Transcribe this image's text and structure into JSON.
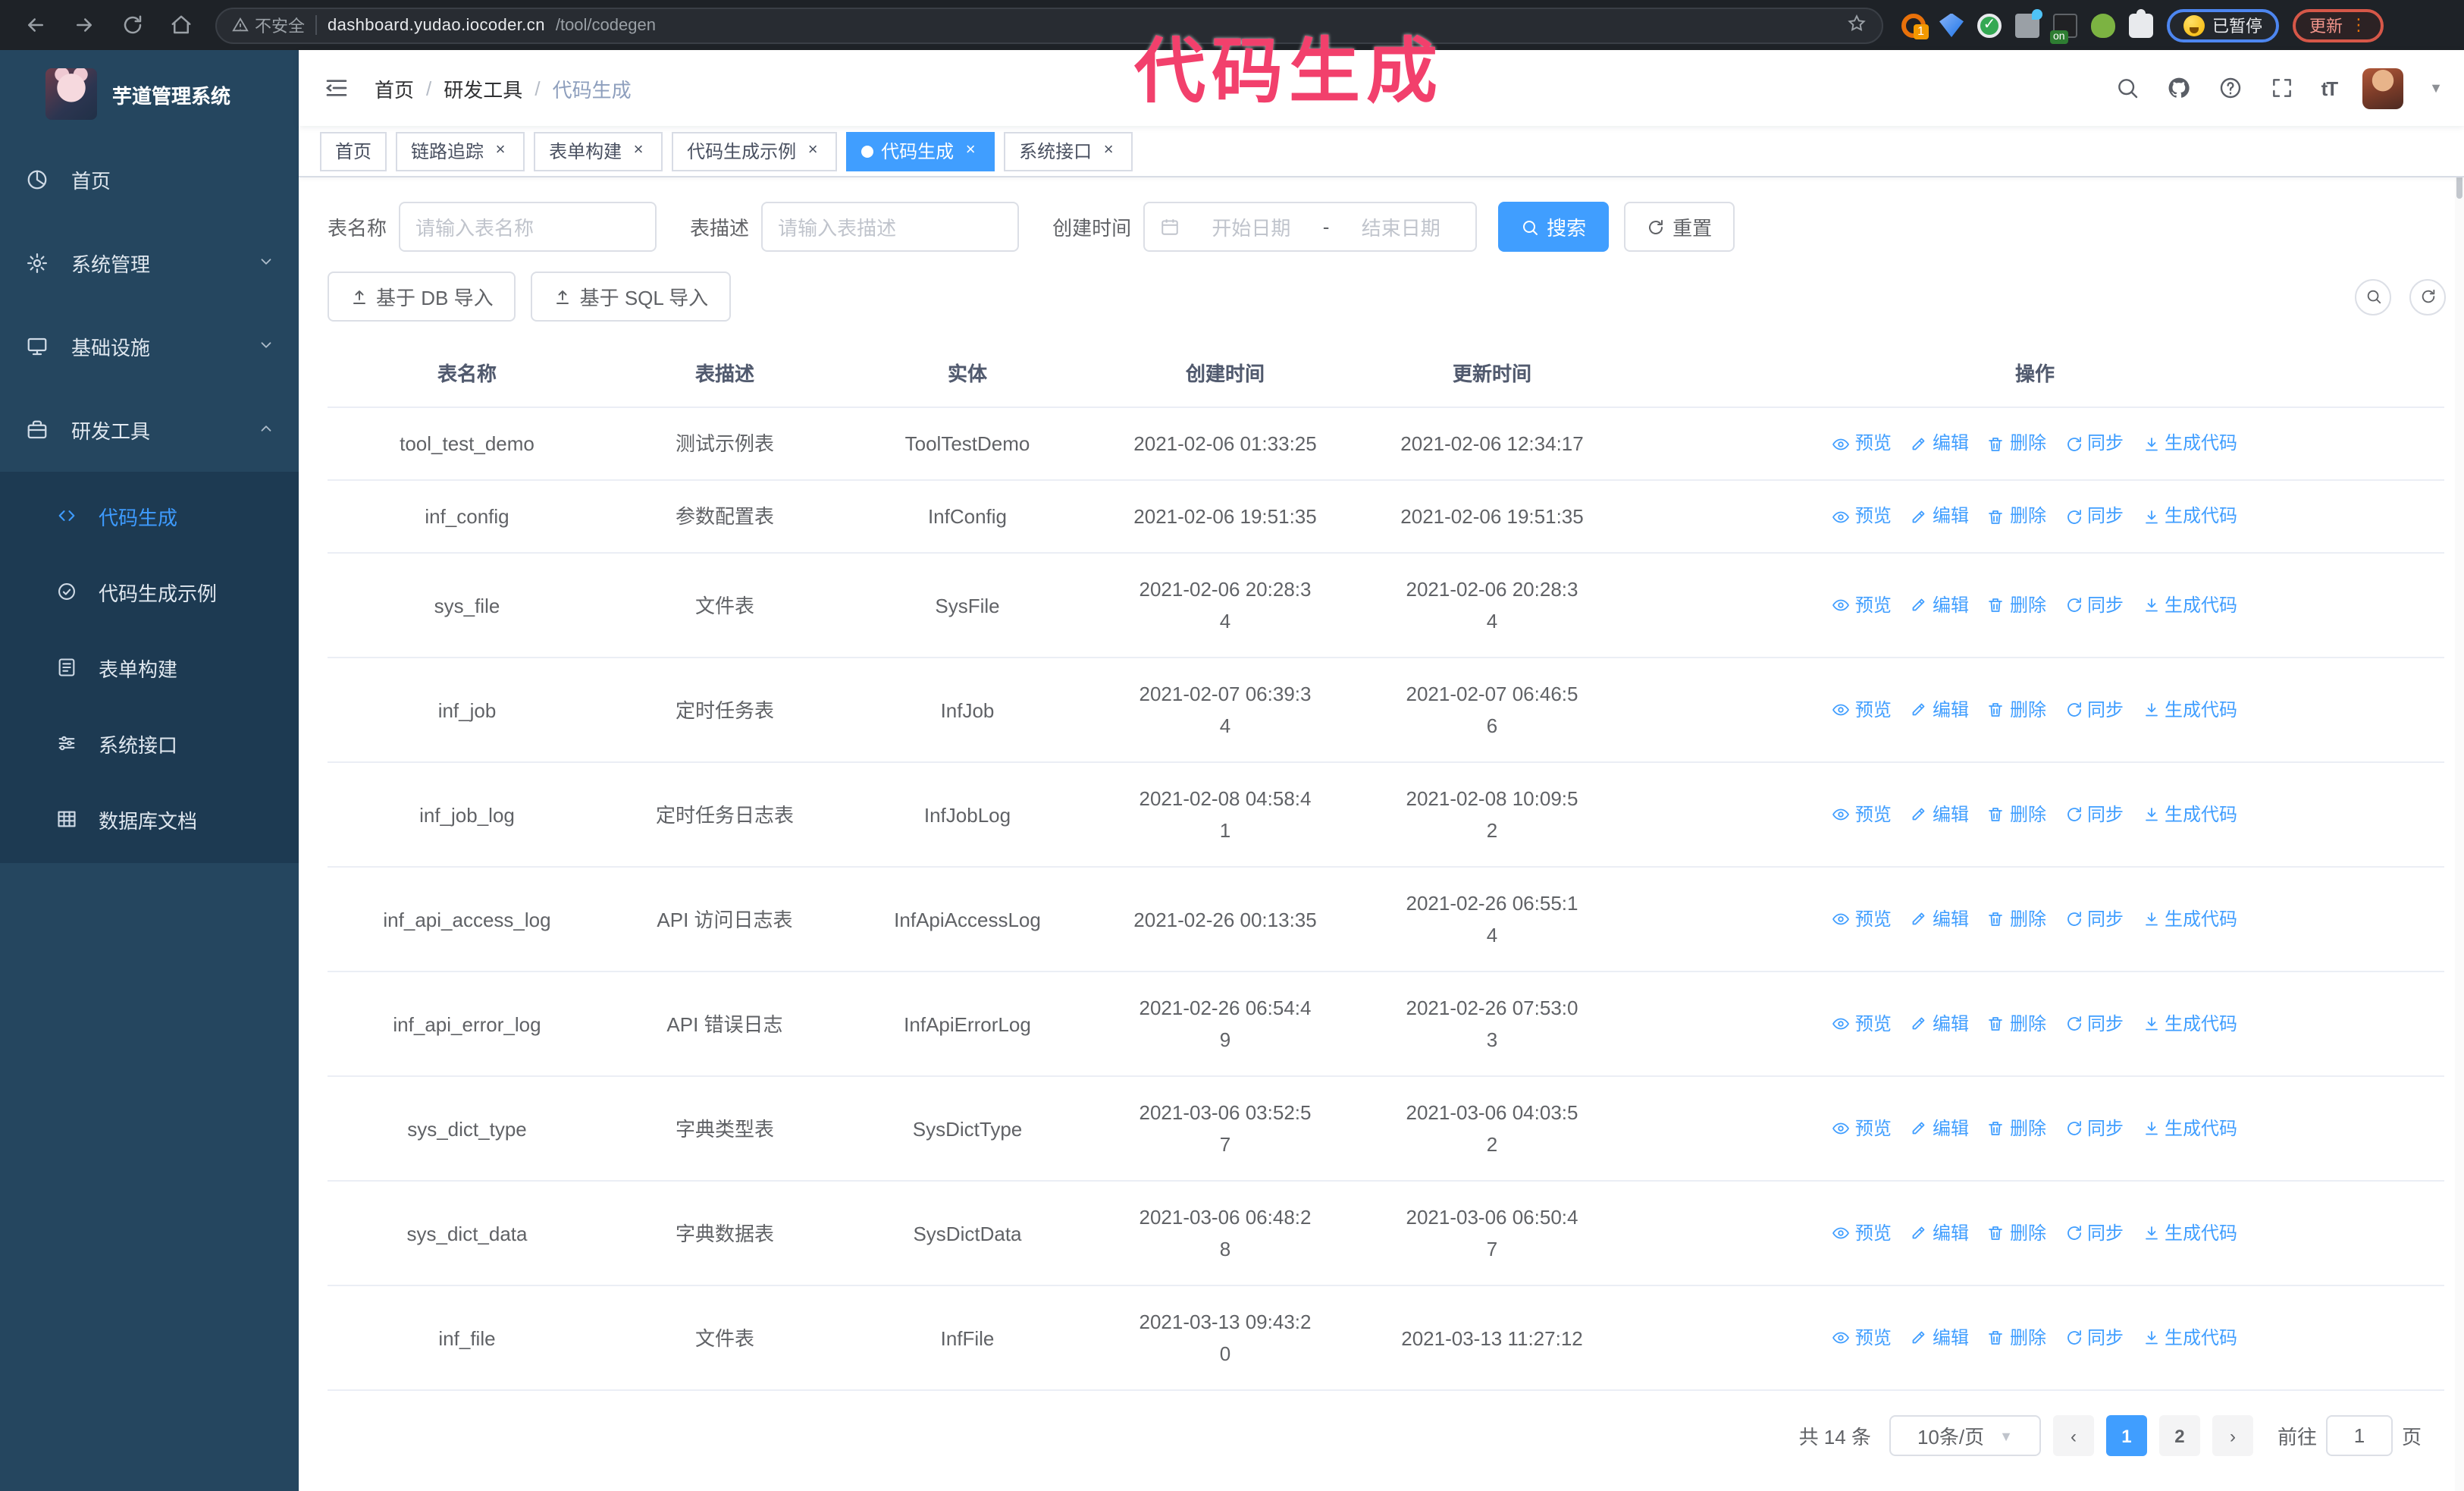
{
  "browser": {
    "security_label": "不安全",
    "url_host": "dashboard.yudao.iocoder.cn",
    "url_path": "/tool/codegen",
    "extension_badge": "1",
    "extension_on_badge": "on",
    "extension_check": "✓",
    "paused_button": "已暂停",
    "update_button": "更新",
    "update_menu_dots": "⋮"
  },
  "annotation": {
    "text": "代码生成",
    "color": "#f2406c"
  },
  "sidebar": {
    "app_title": "芋道管理系统",
    "items": [
      {
        "label": "首页"
      },
      {
        "label": "系统管理"
      },
      {
        "label": "基础设施"
      },
      {
        "label": "研发工具"
      }
    ],
    "submenu": [
      {
        "label": "代码生成",
        "active": true
      },
      {
        "label": "代码生成示例"
      },
      {
        "label": "表单构建"
      },
      {
        "label": "系统接口"
      },
      {
        "label": "数据库文档"
      }
    ]
  },
  "header": {
    "breadcrumb": [
      "首页",
      "研发工具",
      "代码生成"
    ],
    "breadcrumb_separator": "/",
    "font_size_icon_text": "tT",
    "avatar_caret": "▼"
  },
  "tabs": [
    {
      "label": "首页"
    },
    {
      "label": "链路追踪"
    },
    {
      "label": "表单构建"
    },
    {
      "label": "代码生成示例"
    },
    {
      "label": "代码生成"
    },
    {
      "label": "系统接口"
    }
  ],
  "tab_close_glyph": "×",
  "filters": {
    "table_name_label": "表名称",
    "table_name_placeholder": "请输入表名称",
    "table_desc_label": "表描述",
    "table_desc_placeholder": "请输入表描述",
    "create_time_label": "创建时间",
    "date_start_placeholder": "开始日期",
    "date_separator": "-",
    "date_end_placeholder": "结束日期",
    "search_button": "搜索",
    "reset_button": "重置"
  },
  "toolbar": {
    "import_db_button": "基于 DB 导入",
    "import_sql_button": "基于 SQL 导入"
  },
  "table": {
    "columns": [
      "表名称",
      "表描述",
      "实体",
      "创建时间",
      "更新时间",
      "操作"
    ],
    "row_actions": [
      {
        "icon": "eye-icon",
        "label": "预览",
        "name": "preview-link"
      },
      {
        "icon": "edit-icon",
        "label": "编辑",
        "name": "edit-link"
      },
      {
        "icon": "delete-icon",
        "label": "删除",
        "name": "delete-link"
      },
      {
        "icon": "sync-icon",
        "label": "同步",
        "name": "sync-link"
      },
      {
        "icon": "generate-icon",
        "label": "生成代码",
        "name": "generate-code-link"
      }
    ],
    "rows": [
      {
        "name": "tool_test_demo",
        "desc": "测试示例表",
        "entity": "ToolTestDemo",
        "created": "2021-02-06 01:33:25",
        "updated": "2021-02-06 12:34:17"
      },
      {
        "name": "inf_config",
        "desc": "参数配置表",
        "entity": "InfConfig",
        "created": "2021-02-06 19:51:35",
        "updated": "2021-02-06 19:51:35"
      },
      {
        "name": "sys_file",
        "desc": "文件表",
        "entity": "SysFile",
        "created": "2021-02-06 20:28:3\n4",
        "updated": "2021-02-06 20:28:3\n4"
      },
      {
        "name": "inf_job",
        "desc": "定时任务表",
        "entity": "InfJob",
        "created": "2021-02-07 06:39:3\n4",
        "updated": "2021-02-07 06:46:5\n6"
      },
      {
        "name": "inf_job_log",
        "desc": "定时任务日志表",
        "entity": "InfJobLog",
        "created": "2021-02-08 04:58:4\n1",
        "updated": "2021-02-08 10:09:5\n2"
      },
      {
        "name": "inf_api_access_log",
        "desc": "API 访问日志表",
        "entity": "InfApiAccessLog",
        "created": "2021-02-26 00:13:35",
        "updated": "2021-02-26 06:55:1\n4"
      },
      {
        "name": "inf_api_error_log",
        "desc": "API 错误日志",
        "entity": "InfApiErrorLog",
        "created": "2021-02-26 06:54:4\n9",
        "updated": "2021-02-26 07:53:0\n3"
      },
      {
        "name": "sys_dict_type",
        "desc": "字典类型表",
        "entity": "SysDictType",
        "created": "2021-03-06 03:52:5\n7",
        "updated": "2021-03-06 04:03:5\n2"
      },
      {
        "name": "sys_dict_data",
        "desc": "字典数据表",
        "entity": "SysDictData",
        "created": "2021-03-06 06:48:2\n8",
        "updated": "2021-03-06 06:50:4\n7"
      },
      {
        "name": "inf_file",
        "desc": "文件表",
        "entity": "InfFile",
        "created": "2021-03-13 09:43:2\n0",
        "updated": "2021-03-13 11:27:12"
      }
    ]
  },
  "pagination": {
    "total_text": "共 14 条",
    "page_size": "10条/页",
    "prev_glyph": "‹",
    "next_glyph": "›",
    "pages": [
      "1",
      "2"
    ],
    "active_page": "1",
    "goto_label": "前往",
    "goto_value": "1",
    "goto_suffix": "页"
  },
  "colors": {
    "accent": "#409eff",
    "sidebar_bg": "#25465f",
    "submenu_bg": "#1d3a52",
    "annotation": "#f2406c",
    "tag_active": "#409eff"
  }
}
